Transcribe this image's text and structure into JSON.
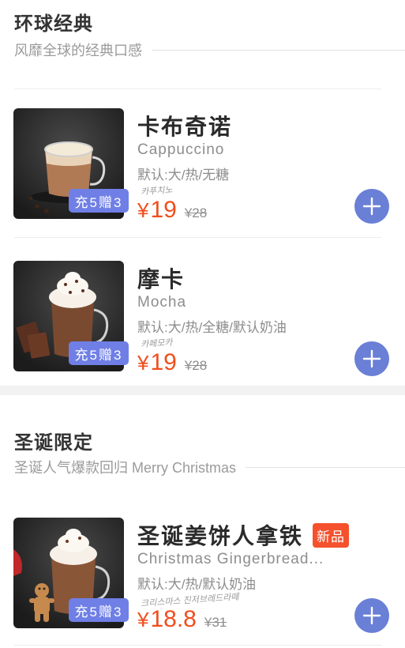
{
  "sections": [
    {
      "title": "环球经典",
      "subtitle": "风靡全球的经典口感",
      "items": [
        {
          "name": "卡布奇诺",
          "english": "Cappuccino",
          "spec": "默认:大/热/无糖",
          "handwriting": "카푸치노",
          "price_symbol": "¥",
          "price": "19",
          "original_price": "¥28",
          "promo": "充5赠3",
          "new_badge": ""
        },
        {
          "name": "摩卡",
          "english": "Mocha",
          "spec": "默认:大/热/全糖/默认奶油",
          "handwriting": "카페모카",
          "price_symbol": "¥",
          "price": "19",
          "original_price": "¥28",
          "promo": "充5赠3",
          "new_badge": ""
        }
      ]
    },
    {
      "title": "圣诞限定",
      "subtitle": "圣诞人气爆款回归 Merry Christmas",
      "items": [
        {
          "name": "圣诞姜饼人拿铁",
          "english": "Christmas Gingerbread...",
          "spec": "默认:大/热/默认奶油",
          "handwriting": "크리스마스 진저브레드라떼",
          "price_symbol": "¥",
          "price": "18.8",
          "original_price": "¥31",
          "promo": "充5赠3",
          "new_badge": "新品"
        }
      ]
    }
  ],
  "colors": {
    "price": "#f04e1e",
    "promo_bg": "#6f7fe5",
    "add_button": "#6a7fd6",
    "new_badge": "#f4512c"
  },
  "icons": {
    "add": "plus-icon"
  }
}
